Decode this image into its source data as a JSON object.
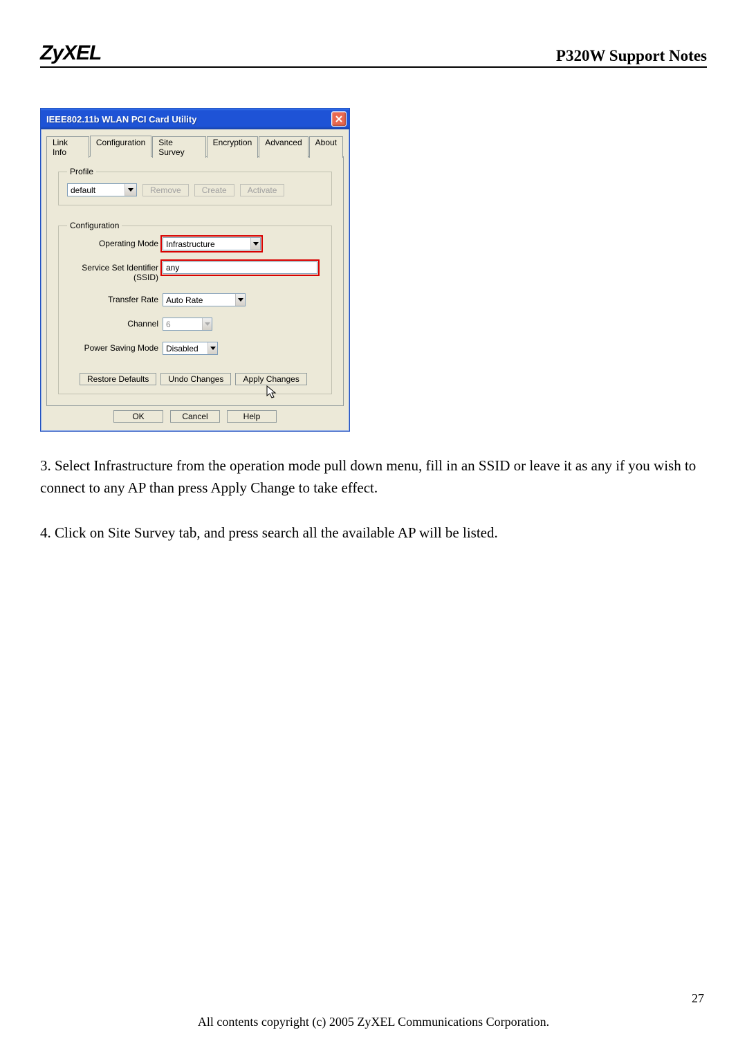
{
  "header": {
    "logo": "ZyXEL",
    "title": "P320W Support Notes"
  },
  "window": {
    "title": "IEEE802.11b WLAN PCI Card Utility",
    "tabs": [
      "Link Info",
      "Configuration",
      "Site Survey",
      "Encryption",
      "Advanced",
      "About"
    ],
    "profile": {
      "legend": "Profile",
      "value": "default",
      "remove": "Remove",
      "create": "Create",
      "activate": "Activate"
    },
    "config": {
      "legend": "Configuration",
      "operating_mode_label": "Operating Mode",
      "operating_mode_value": "Infrastructure",
      "ssid_label": "Service Set Identifier",
      "ssid_sub": "(SSID)",
      "ssid_value": "any",
      "transfer_rate_label": "Transfer Rate",
      "transfer_rate_value": "Auto Rate",
      "channel_label": "Channel",
      "channel_value": "6",
      "psm_label": "Power Saving Mode",
      "psm_value": "Disabled",
      "restore": "Restore Defaults",
      "undo": "Undo Changes",
      "apply": "Apply Changes"
    },
    "buttons": {
      "ok": "OK",
      "cancel": "Cancel",
      "help": "Help"
    }
  },
  "para1": "3. Select Infrastructure from the operation mode pull down menu, fill in an SSID or leave it as any if you wish to connect to any AP than press Apply Change to take effect.",
  "para2": "4. Click on Site Survey tab, and press search all the available AP will be listed.",
  "footer": "All contents copyright (c) 2005 ZyXEL Communications Corporation.",
  "page_num": "27"
}
